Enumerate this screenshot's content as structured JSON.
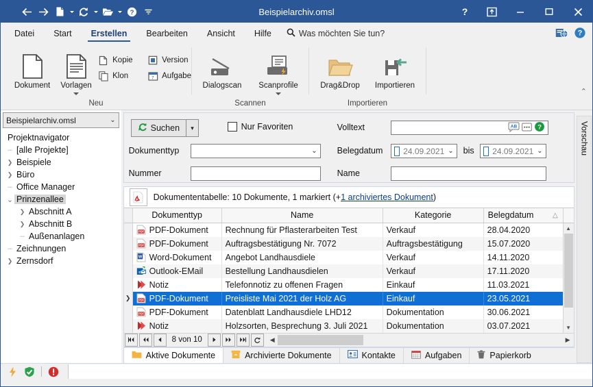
{
  "titlebar": {
    "title": "Beispielarchiv.omsl",
    "nav": [
      {
        "name": "back-icon",
        "glyph": "←"
      },
      {
        "name": "forward-icon",
        "glyph": "→"
      },
      {
        "name": "new-document-icon",
        "glyph": "doc"
      },
      {
        "name": "refresh-icon",
        "glyph": "refresh"
      },
      {
        "name": "open-folder-icon",
        "glyph": "folder"
      },
      {
        "name": "help-icon",
        "glyph": "?"
      },
      {
        "name": "overflow-icon",
        "glyph": "⌄"
      }
    ],
    "help_label": "?",
    "restore_label": "⤒",
    "minimize_label": "—",
    "maximize_label": "❐",
    "close_label": "✕"
  },
  "menubar": {
    "tabs": [
      {
        "label": "Datei",
        "active": false
      },
      {
        "label": "Start",
        "active": false
      },
      {
        "label": "Erstellen",
        "active": true
      },
      {
        "label": "Bearbeiten",
        "active": false
      },
      {
        "label": "Ansicht",
        "active": false
      },
      {
        "label": "Hilfe",
        "active": false
      }
    ],
    "tellme": "Was möchten Sie tun?"
  },
  "ribbon": {
    "groups": [
      {
        "label": "Neu",
        "big": [
          {
            "label": "Dokument",
            "icon": "page-icon",
            "dropdown": false
          },
          {
            "label": "Vorlagen",
            "icon": "templates-icon",
            "dropdown": true
          }
        ],
        "small": [
          {
            "label": "Kopie",
            "icon": "copy-icon"
          },
          {
            "label": "Version",
            "icon": "version-icon"
          },
          {
            "label": "Klon",
            "icon": "clone-icon"
          },
          {
            "label": "Aufgabe",
            "icon": "task-icon"
          }
        ]
      },
      {
        "label": "Scannen",
        "big": [
          {
            "label": "Dialogscan",
            "icon": "scanner-icon",
            "dropdown": false
          },
          {
            "label": "Scanprofile",
            "icon": "scanprofile-icon",
            "dropdown": true
          }
        ],
        "small": []
      },
      {
        "label": "Importieren",
        "big": [
          {
            "label": "Drag&Drop",
            "icon": "folder-icon",
            "dropdown": false
          },
          {
            "label": "Importieren",
            "icon": "import-icon",
            "dropdown": false
          }
        ],
        "small": []
      }
    ],
    "collapse_label": "⌃"
  },
  "sidebar": {
    "archive_select": "Beispielarchiv.omsl",
    "root_label": "Projektnavigator",
    "items": [
      {
        "label": "[alle Projekte]",
        "indent": 1,
        "state": "leaf",
        "selected": false
      },
      {
        "label": "Beispiele",
        "indent": 1,
        "state": "collapsed",
        "selected": false
      },
      {
        "label": "Büro",
        "indent": 1,
        "state": "collapsed",
        "selected": false
      },
      {
        "label": "Office Manager",
        "indent": 1,
        "state": "leaf",
        "selected": false
      },
      {
        "label": "Prinzenallee",
        "indent": 1,
        "state": "expanded",
        "selected": true
      },
      {
        "label": "Abschnitt A",
        "indent": 2,
        "state": "collapsed",
        "selected": false
      },
      {
        "label": "Abschnitt B",
        "indent": 2,
        "state": "collapsed",
        "selected": false
      },
      {
        "label": "Außenanlagen",
        "indent": 2,
        "state": "leaf",
        "selected": false
      },
      {
        "label": "Zeichnungen",
        "indent": 1,
        "state": "leaf",
        "selected": false
      },
      {
        "label": "Zernsdorf",
        "indent": 1,
        "state": "collapsed",
        "selected": false
      }
    ]
  },
  "search": {
    "search_button": "Suchen",
    "favorites_label": "Nur Favoriten",
    "favorites_checked": false,
    "doctype_label": "Dokumenttyp",
    "doctype_value": "",
    "number_label": "Nummer",
    "number_value": "",
    "fulltext_label": "Volltext",
    "fulltext_value": "",
    "date_label": "Belegdatum",
    "date_from": "24.09.2021",
    "date_to": "24.09.2021",
    "date_between": "bis",
    "date_from_checked": false,
    "date_to_checked": false,
    "name_label": "Name",
    "name_value": "",
    "ab_icon": "AB",
    "more_icon": "…",
    "help_icon": "?"
  },
  "doctable": {
    "caption_prefix": "Dokumententabelle:",
    "caption_count": "10 Dokumente, 1 markiert (+",
    "caption_link": "1 archiviertes Dokument",
    "caption_suffix": ")",
    "columns": [
      "Dokumenttyp",
      "Name",
      "Kategorie",
      "Belegdatum"
    ],
    "sort_indicator": "△",
    "rows": [
      {
        "type": "PDF-Dokument",
        "icon": "pdf-icon",
        "name": "Rechnung für Pflasterarbeiten Test",
        "kategorie": "Verkauf",
        "datum": "28.04.2020",
        "selected": false
      },
      {
        "type": "PDF-Dokument",
        "icon": "pdf-icon",
        "name": "Auftragsbestätigung Nr. 7072",
        "kategorie": "Auftragsbestätigung",
        "datum": "15.07.2020",
        "selected": false
      },
      {
        "type": "Word-Dokument",
        "icon": "word-icon",
        "name": "Angebot Landhausdiele",
        "kategorie": "Verkauf",
        "datum": "14.11.2020",
        "selected": false
      },
      {
        "type": "Outlook-EMail",
        "icon": "outlook-icon",
        "name": "Bestellung Landhausdielen",
        "kategorie": "Verkauf",
        "datum": "17.11.2020",
        "selected": false
      },
      {
        "type": "Notiz",
        "icon": "note-icon",
        "name": "Telefonnotiz zu offenen Fragen",
        "kategorie": "Einkauf",
        "datum": "11.03.2021",
        "selected": false
      },
      {
        "type": "PDF-Dokument",
        "icon": "pdf-icon",
        "name": "Preisliste Mai 2021 der Holz AG",
        "kategorie": "Einkauf",
        "datum": "23.05.2021",
        "selected": true
      },
      {
        "type": "PDF-Dokument",
        "icon": "pdf-icon",
        "name": "Datenblatt Landhausdiele LHD12",
        "kategorie": "Dokumentation",
        "datum": "30.06.2021",
        "selected": false
      },
      {
        "type": "Notiz",
        "icon": "note-icon",
        "name": "Holzsorten, Besprechung 3. Juli 2021",
        "kategorie": "Dokumentation",
        "datum": "03.07.2021",
        "selected": false
      }
    ],
    "pager": {
      "first": "⏮",
      "prev_block": "⏪",
      "prev": "◀",
      "position": "8 von 10",
      "next": "▶",
      "next_block": "⏩",
      "last": "⏭",
      "refresh": "↻"
    }
  },
  "bottom_tabs": [
    {
      "label": "Aktive Dokumente",
      "icon": "folder-icon",
      "active": true
    },
    {
      "label": "Archivierte Dokumente",
      "icon": "archive-icon",
      "active": false
    },
    {
      "label": "Kontakte",
      "icon": "contacts-icon",
      "active": false
    },
    {
      "label": "Aufgaben",
      "icon": "calendar-icon",
      "active": false
    },
    {
      "label": "Papierkorb",
      "icon": "trash-icon",
      "active": false
    }
  ],
  "preview": {
    "label": "Vorschau"
  },
  "statusbar": {
    "icons": [
      {
        "name": "lightning-icon"
      },
      {
        "name": "shield-ok-icon"
      },
      {
        "name": "error-icon"
      }
    ]
  },
  "colors": {
    "titlebar": "#2b5797",
    "accent": "#2b5797",
    "selection": "#0f6fd4",
    "link": "#0b3d91",
    "ribbon_bg": "#f0f0f0",
    "green": "#1a9a3c",
    "red": "#cf2b2b",
    "orange": "#f2a93b"
  }
}
